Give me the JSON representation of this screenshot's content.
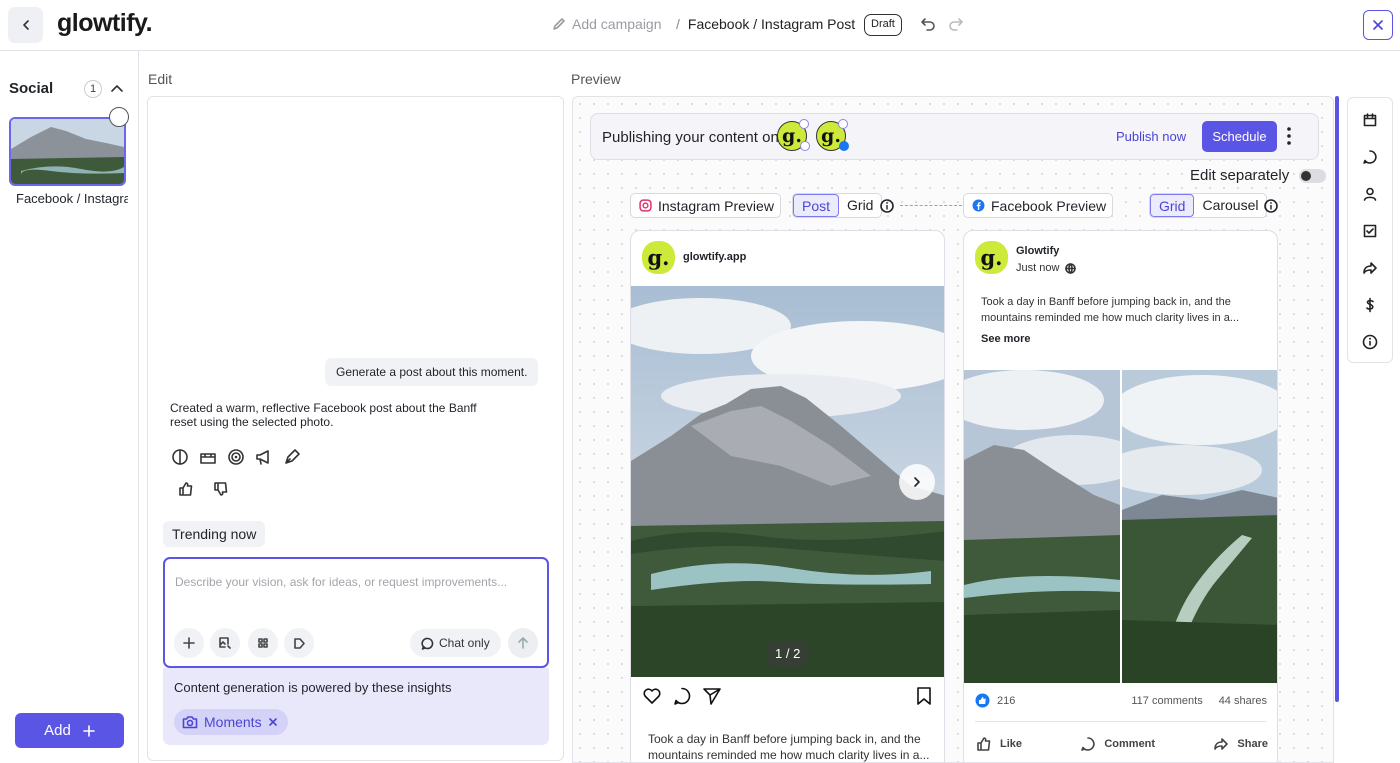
{
  "app": {
    "logo": "glowtify."
  },
  "header": {
    "campaign_placeholder": "Add campaign",
    "separator": "/",
    "post_title": "Facebook / Instagram Post",
    "status_badge": "Draft"
  },
  "sidebar": {
    "section_title": "Social",
    "count": "1",
    "item_label": "Facebook / Instagram Post",
    "add_button": "Add"
  },
  "edit": {
    "label": "Edit",
    "user_message": "Generate a post about this moment.",
    "ai_message": "Created a warm, reflective Facebook post about the Banff reset using the selected photo.",
    "trending": "Trending now",
    "composer_placeholder": "Describe your vision, ask for ideas, or request improvements...",
    "chat_only": "Chat only",
    "insights_text": "Content generation is powered by these insights",
    "insight_chip": "Moments"
  },
  "preview": {
    "label": "Preview",
    "publishing_text": "Publishing your content on",
    "publish_now": "Publish now",
    "schedule": "Schedule",
    "edit_separately": "Edit separately",
    "edit_separately_on": false,
    "instagram": {
      "tab_label": "Instagram Preview",
      "modes": [
        "Post",
        "Grid"
      ],
      "active_mode": "Post",
      "username": "glowtify.app",
      "counter": "1 / 2",
      "caption": "Took a day in Banff before jumping back in, and the mountains reminded me how much clarity lives in a..."
    },
    "facebook": {
      "tab_label": "Facebook Preview",
      "modes": [
        "Grid",
        "Carousel"
      ],
      "active_mode": "Grid",
      "page_name": "Glowtify",
      "time": "Just now",
      "text": "Took a day in Banff before jumping back in, and the mountains reminded me how much clarity lives in a...",
      "see_more": "See more",
      "likes": "216",
      "comments": "117 comments",
      "shares": "44 shares",
      "actions": [
        "Like",
        "Comment",
        "Share"
      ]
    }
  },
  "colors": {
    "accent": "#5b55e6",
    "brand_avatar": "#cdea3b",
    "facebook_blue": "#1877f2"
  }
}
